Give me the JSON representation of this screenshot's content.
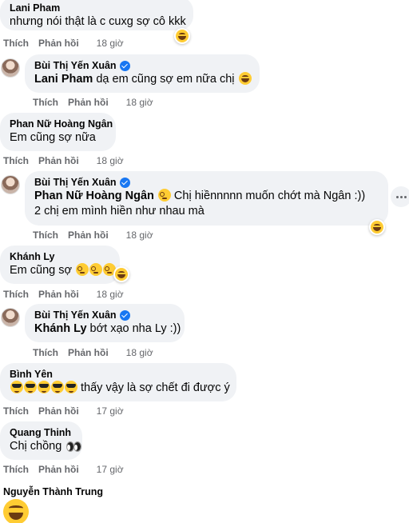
{
  "labels": {
    "like": "Thích",
    "reply": "Phản hồi"
  },
  "comments": [
    {
      "author": "Lani Pham",
      "text": "nhưng nói thật là c cuxg sợ cô kkk",
      "time": "18 giờ"
    },
    {
      "author": "Bùi Thị Yến Xuân",
      "mention": "Lani Pham",
      "text": " dạ em cũng sợ em nữa chị",
      "time": "18 giờ",
      "emoji": "grin-icon"
    },
    {
      "author": "Phan Nữ Hoàng Ngân",
      "text": "Em cũng sợ nữa",
      "time": "18 giờ"
    },
    {
      "author": "Bùi Thị Yến Xuân",
      "mention": "Phan Nữ Hoàng Ngân",
      "text": " Chị hiềnnnnn muốn chớt mà Ngân :))",
      "text2": "2 chị em mình hiền như nhau mà",
      "time": "18 giờ"
    },
    {
      "author": "Khánh Ly",
      "text": "Em cũng sợ",
      "time": "18 giờ"
    },
    {
      "author": "Bùi Thị Yến Xuân",
      "mention": "Khánh Ly",
      "text": " bớt xạo nha Ly :))",
      "time": "18 giờ"
    },
    {
      "author": "Bình Yên",
      "text": " thấy vậy là sợ chết đi được ý",
      "time": "17 giờ"
    },
    {
      "author": "Quang Thinh",
      "text": "Chị chồng",
      "time": "17 giờ"
    },
    {
      "author": "Nguyễn Thành Trung"
    }
  ]
}
